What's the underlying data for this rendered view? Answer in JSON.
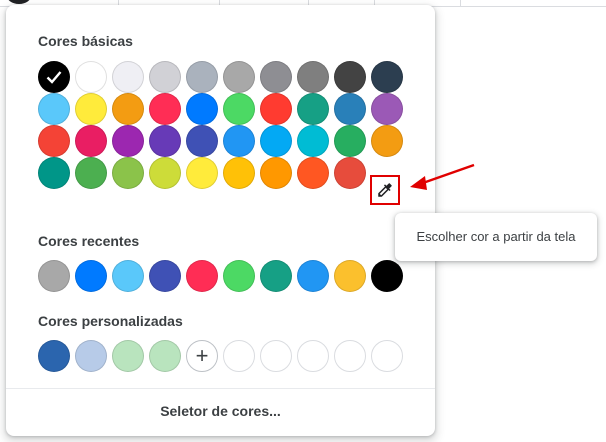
{
  "palette": {
    "basic_title": "Cores básicas",
    "recent_title": "Cores recentes",
    "custom_title": "Cores personalizadas",
    "picker_label": "Seletor de cores...",
    "add_label": "+",
    "selected_color": "#000000",
    "basic_rows": [
      [
        "#000000",
        "#ffffff",
        "#efeff4",
        "#d1d1d6",
        "#aab2bd",
        "#a8a8a8",
        "#8e8e93",
        "#7f7f7f",
        "#434343",
        "#2c3e50"
      ],
      [
        "#5ac8fa",
        "#ffeb3b",
        "#f39c12",
        "#ff2d55",
        "#007aff",
        "#4cd964",
        "#ff3b30",
        "#16a085",
        "#2980b9",
        "#9b59b6"
      ],
      [
        "#f44336",
        "#e91e63",
        "#9c27b0",
        "#673ab7",
        "#3f51b5",
        "#2196f3",
        "#03a9f4",
        "#00bcd4",
        "#27ae60",
        "#f39c12"
      ],
      [
        "#009688",
        "#4caf50",
        "#8bc34a",
        "#cddc39",
        "#ffeb3b",
        "#ffc107",
        "#ff9800",
        "#ff5722",
        "#e74c3c"
      ]
    ],
    "recent": [
      "#a8a8a8",
      "#007aff",
      "#5ac8fa",
      "#3f51b5",
      "#ff2d55",
      "#4cd964",
      "#16a085",
      "#2196f3",
      "#fbc02d",
      "#000000"
    ],
    "custom": [
      "#2b65ae",
      "#b7cbe8",
      "#b9e4be",
      "#b9e4be"
    ],
    "custom_empty_slots": 5
  },
  "eyedropper": {
    "icon": "eyedropper-icon",
    "highlight_color": "#e00000"
  },
  "tooltip": {
    "text": "Escolher cor a partir da tela"
  },
  "annotation": {
    "arrow_color": "#e00000"
  }
}
